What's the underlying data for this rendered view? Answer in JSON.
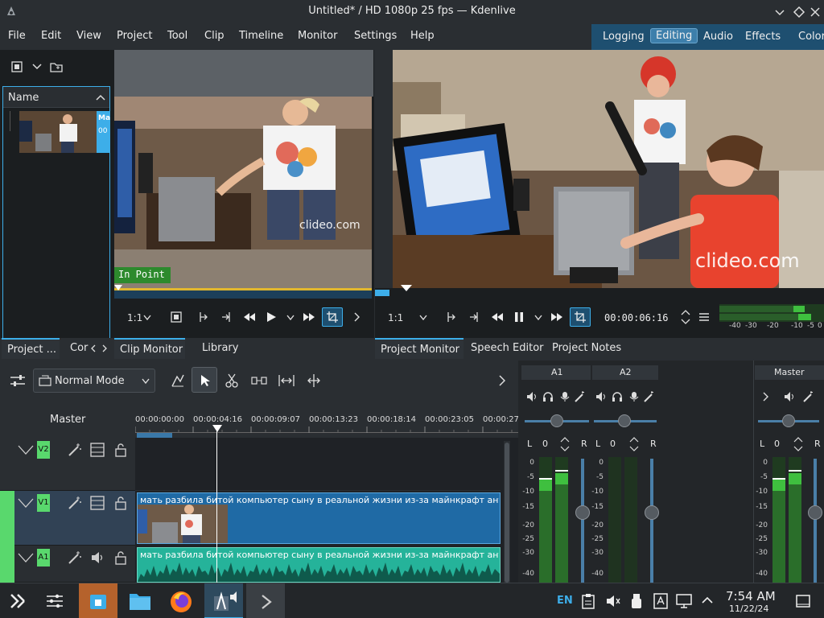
{
  "window": {
    "title": "Untitled* / HD 1080p 25 fps — Kdenlive"
  },
  "menu": [
    "File",
    "Edit",
    "View",
    "Project",
    "Tool",
    "Clip",
    "Timeline",
    "Monitor",
    "Settings",
    "Help"
  ],
  "layouts": {
    "items": [
      "Logging",
      "Editing",
      "Audio",
      "Effects",
      "Color"
    ],
    "active": "Editing"
  },
  "bin": {
    "name_header": "Name",
    "clip_badge": "Ma",
    "clip_badge2": "00",
    "tabs": [
      "Project ...",
      "Cor"
    ]
  },
  "clip_monitor": {
    "badge": "In Point",
    "watermark": "clideo.com",
    "zoom": "1:1",
    "tabs": [
      "Clip Monitor",
      "Library"
    ]
  },
  "project_monitor": {
    "watermark": "clideo.com",
    "zoom": "1:1",
    "timecode": "00:00:06:16",
    "meter_scale": [
      "-40",
      "-30",
      "-20",
      "-10",
      "-5",
      "0"
    ],
    "tabs": [
      "Project Monitor",
      "Speech Editor",
      "Project Notes"
    ]
  },
  "timeline": {
    "mode": "Normal Mode",
    "master_label": "Master",
    "ruler": [
      "00:00:00:00",
      "00:00:04:16",
      "00:00:09:07",
      "00:00:13:23",
      "00:00:18:14",
      "00:00:23:05",
      "00:00:27"
    ],
    "tracks": [
      {
        "id": "V2",
        "color": "#59d86d"
      },
      {
        "id": "V1",
        "color": "#59d86d"
      },
      {
        "id": "A1",
        "color": "#59d86d"
      }
    ],
    "clip_title": "мать разбила битой компьютер сыну в реальной жизни из-за майнкрафт анти-гри",
    "audio_clip_title": "мать разбила битой компьютер сыну в реальной жизни из-за майнкрафт анти-гри"
  },
  "mixer": {
    "channels": [
      "A1",
      "A2"
    ],
    "master": "Master",
    "left": "L",
    "right": "R",
    "gain": "0",
    "scale": [
      "0",
      "-5",
      "-10",
      "-15",
      "-20",
      "-25",
      "-30",
      "-40"
    ]
  },
  "taskbar": {
    "lang": "EN",
    "time": "7:54 AM",
    "date": "11/22/24"
  },
  "colors": {
    "accent": "#3daee9",
    "clip_video": "#1f6aa5",
    "clip_audio": "#25b39a",
    "track_tag": "#59d86d",
    "meter": "#3fbf3f"
  }
}
